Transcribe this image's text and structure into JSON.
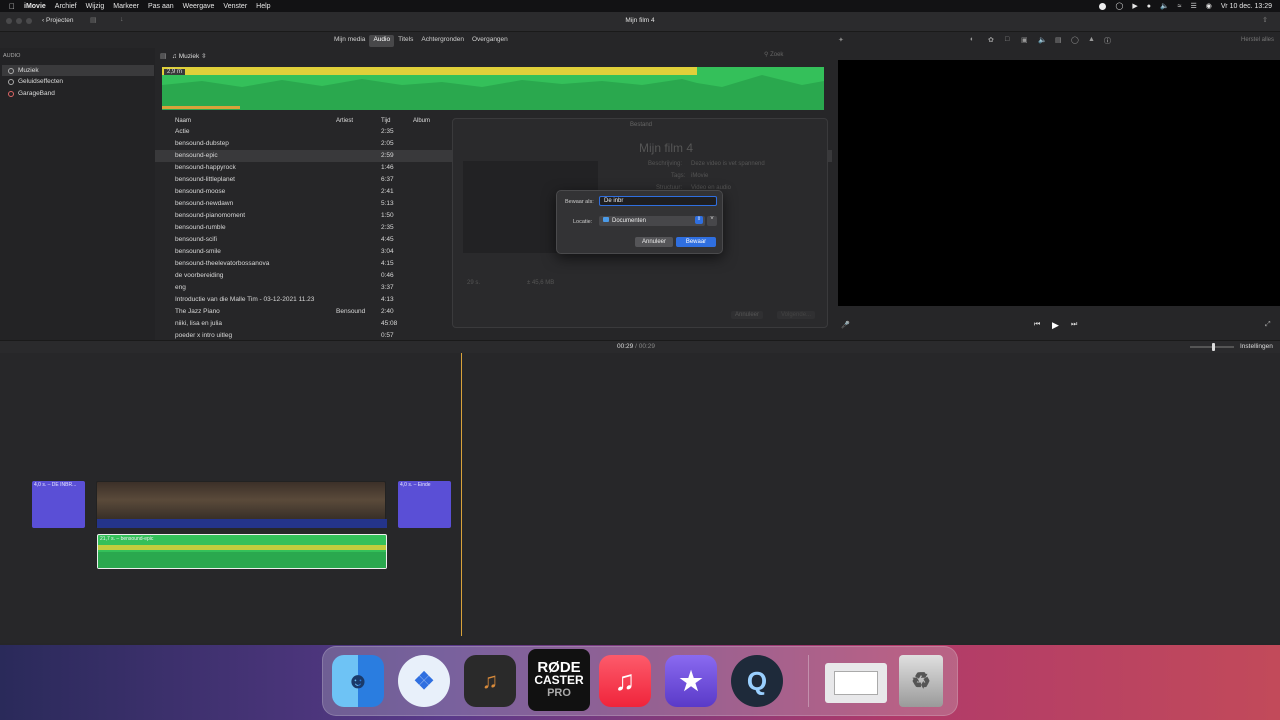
{
  "menubar": {
    "apple": "",
    "app": "iMovie",
    "items": [
      "Archief",
      "Wijzig",
      "Markeer",
      "Pas aan",
      "Weergave",
      "Venster",
      "Help"
    ],
    "clock": "Vr 10 dec.  13:29"
  },
  "toolbar": {
    "projects_label": "Projecten",
    "title": "Mijn film 4"
  },
  "browser_tabs": [
    "Mijn media",
    "Audio",
    "Titels",
    "Achtergronden",
    "Overgangen"
  ],
  "selected_tab": "Audio",
  "sidebar": {
    "header": "AUDIO",
    "items": [
      "Muziek",
      "Geluidseffecten",
      "GarageBand"
    ]
  },
  "browser": {
    "source": "Muziek",
    "search_placeholder": "Zoek",
    "waveform_label": "2,9 m",
    "columns": [
      "Naam",
      "Artiest",
      "Tijd",
      "Album"
    ],
    "rows": [
      {
        "name": "Actie",
        "artist": "",
        "time": "2:35"
      },
      {
        "name": "bensound-dubstep",
        "artist": "",
        "time": "2:05"
      },
      {
        "name": "bensound-epic",
        "artist": "",
        "time": "2:59"
      },
      {
        "name": "bensound-happyrock",
        "artist": "",
        "time": "1:46"
      },
      {
        "name": "bensound-littleplanet",
        "artist": "",
        "time": "6:37"
      },
      {
        "name": "bensound-moose",
        "artist": "",
        "time": "2:41"
      },
      {
        "name": "bensound-newdawn",
        "artist": "",
        "time": "5:13"
      },
      {
        "name": "bensound-pianomoment",
        "artist": "",
        "time": "1:50"
      },
      {
        "name": "bensound-rumble",
        "artist": "",
        "time": "2:35"
      },
      {
        "name": "bensound-scifi",
        "artist": "",
        "time": "4:45"
      },
      {
        "name": "bensound-smile",
        "artist": "",
        "time": "3:04"
      },
      {
        "name": "bensound-theelevatorbossanova",
        "artist": "",
        "time": "4:15"
      },
      {
        "name": "de voorbereiding",
        "artist": "",
        "time": "0:46"
      },
      {
        "name": "eng",
        "artist": "",
        "time": "3:37"
      },
      {
        "name": "Introductie van die Malle Tim - 03-12-2021 11.23",
        "artist": "",
        "time": "4:13"
      },
      {
        "name": "The Jazz Piano",
        "artist": "Bensound",
        "time": "2:40"
      },
      {
        "name": "niiki, lisa en julia",
        "artist": "",
        "time": "45:08"
      },
      {
        "name": "poeder x intro uitleg",
        "artist": "",
        "time": "0:57"
      }
    ]
  },
  "viewer": {
    "reset_label": "Herstel alles",
    "timecode_current": "00:29",
    "timecode_sep": "/",
    "timecode_total": "00:29",
    "settings_label": "Instellingen"
  },
  "share_dialog": {
    "header": "Bestand",
    "title": "Mijn film 4",
    "desc_label": "Beschrijving:",
    "desc_value": "Deze video is vet spannend",
    "tags_label": "Tags:",
    "tags_value": "iMovie",
    "struct_label": "Structuur:",
    "struct_value": "Video en audio",
    "duration": "29 s.",
    "size": "± 45,6 MB",
    "cancel": "Annuleer",
    "next": "Volgende..."
  },
  "save_dialog": {
    "save_as_label": "Bewaar als:",
    "save_as_value": "De inbr",
    "location_label": "Locatie:",
    "location_value": "Documenten",
    "cancel": "Annuleer",
    "save": "Bewaar"
  },
  "timeline": {
    "title_clip_1": "4,0 s. – DE INBR...",
    "title_clip_2": "4,0 s. – Einde",
    "audio_clip": "21,7 s. – bensound-epic"
  },
  "dock": {
    "items": [
      "finder-icon",
      "safari-icon",
      "garageband-icon",
      "rodecaster-icon",
      "music-icon",
      "imovie-icon",
      "quicktime-icon",
      "preview-icon",
      "trash-icon"
    ],
    "rode_line1": "RØDE",
    "rode_line2": "CASTER",
    "rode_line3": "PRO"
  },
  "colors": {
    "accent": "#2f6fe0",
    "audio_green": "#34c05a",
    "title_clip": "#5a4fd6",
    "playhead": "#d8a23a"
  }
}
